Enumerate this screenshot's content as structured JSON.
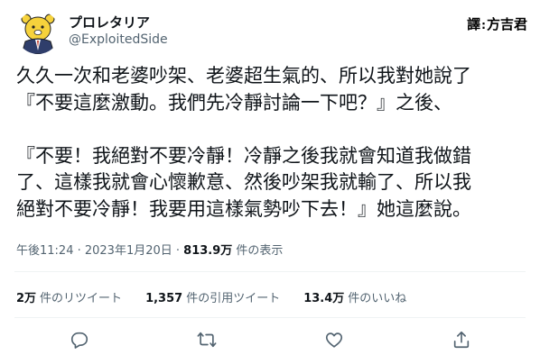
{
  "account": {
    "display_name": "プロレタリア",
    "handle": "@ExploitedSide"
  },
  "translator_credit": {
    "prefix": "譯",
    "separator": ":",
    "name": "方吉君"
  },
  "tweet": {
    "lines": [
      "久久一次和老婆吵架、老婆超生氣的、所以我對她說了",
      "『不要這麼激動。我們先冷靜討論一下吧？』之後、",
      "",
      "『不要！我絕對不要冷靜！冷靜之後我就會知道我做錯",
      "了、這樣我就會心懷歉意、然後吵架我就輸了、所以我",
      "絕對不要冷靜！我要用這樣氣勢吵下去！』她這麼說。"
    ]
  },
  "meta": {
    "timestamp": "午後11:24 · 2023年1月20日",
    "dot": " · ",
    "views_count": "813.9万",
    "views_label": " 件の表示"
  },
  "stats": {
    "retweets_count": "2万",
    "retweets_label": "件のリツイート",
    "quotes_count": "1,357",
    "quotes_label": "件の引用ツイート",
    "likes_count": "13.4万",
    "likes_label": "件のいいね"
  },
  "icons": {
    "reply": "reply-icon",
    "retweet": "retweet-icon",
    "like": "like-icon",
    "share": "share-icon"
  },
  "colors": {
    "text": "#0f1419",
    "secondary": "#536471",
    "divider": "#eff3f4",
    "avatar_yellow": "#f6d23c"
  }
}
